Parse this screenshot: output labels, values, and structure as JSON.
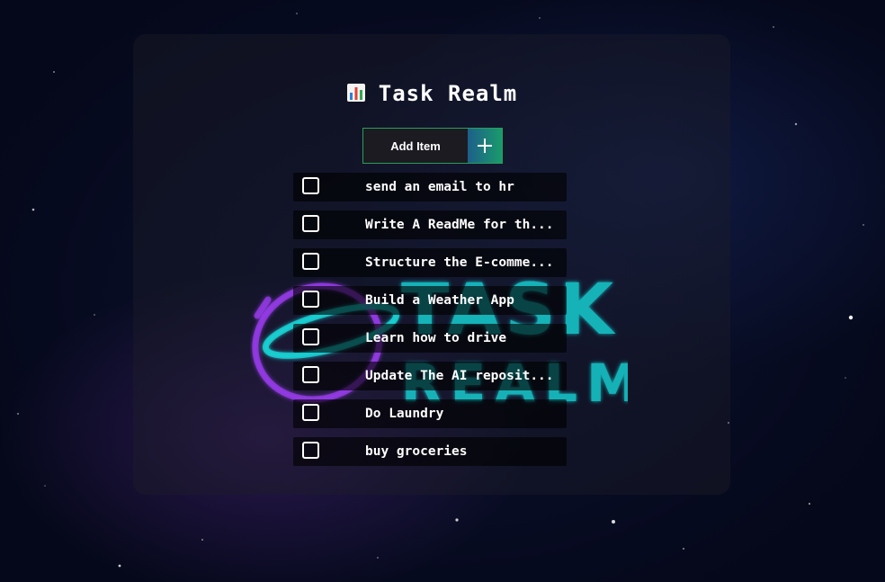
{
  "app": {
    "title": "Task Realm",
    "title_icon": "bar-chart-icon"
  },
  "add": {
    "button_label": "Add Item",
    "plus_icon": "plus-icon"
  },
  "logo": {
    "line1": "TASK",
    "line2": "REALM"
  },
  "tasks": [
    {
      "text": "send an email to hr",
      "checked": false
    },
    {
      "text": "Write A ReadMe for th...",
      "checked": false
    },
    {
      "text": "Structure the E-comme...",
      "checked": false
    },
    {
      "text": "Build a Weather App",
      "checked": false
    },
    {
      "text": "Learn how to drive",
      "checked": false
    },
    {
      "text": "Update The AI reposit...",
      "checked": false
    },
    {
      "text": "Do Laundry",
      "checked": false
    },
    {
      "text": "buy groceries",
      "checked": false
    }
  ],
  "colors": {
    "accent_green": "#2a9d5a",
    "logo_cyan": "#19e6e6",
    "logo_purple": "#9b3cf0"
  }
}
